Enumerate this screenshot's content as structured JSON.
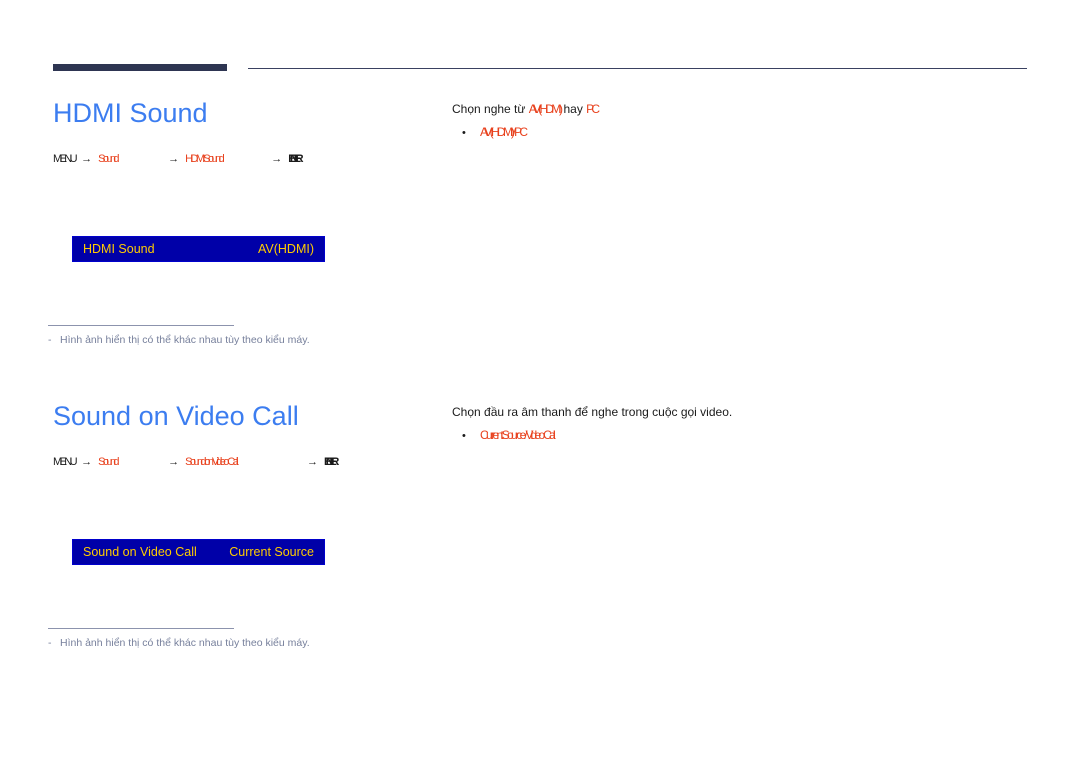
{
  "document": {
    "title": "HDMI Sound / Sound on Video Call"
  },
  "sections": [
    {
      "heading": "HDMI Sound",
      "breadcrumb": {
        "menu": "MENU",
        "arrow": "→",
        "step1": "Sound",
        "step2": "HDMI Sound",
        "enter": "ENTER"
      },
      "osd": {
        "label": "HDMI Sound",
        "value": "AV(HDMI)"
      },
      "footnote": {
        "dash": "-",
        "text": "Hình ảnh hiển thị có thể khác nhau tùy theo kiểu máy."
      },
      "description": {
        "lead": "Chọn nghe từ ",
        "highlight1": "AV(HDMI)",
        "mid": " hay ",
        "highlight2": "PC",
        "tail": ""
      },
      "bullets": [
        {
          "dot": "•",
          "label": "AV(HDMI) / PC"
        }
      ]
    },
    {
      "heading": "Sound on Video Call",
      "breadcrumb": {
        "menu": "MENU",
        "arrow": "→",
        "step1": "Sound",
        "step2": "Sound on Video Call",
        "enter": "ENTER"
      },
      "osd": {
        "label": "Sound on Video Call",
        "value": "Current Source"
      },
      "footnote": {
        "dash": "-",
        "text": "Hình ảnh hiển thị có thể khác nhau tùy theo kiểu máy."
      },
      "description": {
        "lead": "Chọn đầu ra âm thanh để nghe trong cuộc gọi video.",
        "highlight1": "",
        "mid": "",
        "highlight2": "",
        "tail": ""
      },
      "bullets": [
        {
          "dot": "•",
          "label": "Current Source / Video Call"
        }
      ]
    }
  ],
  "colors": {
    "heading": "#3c7df0",
    "rule_dark": "#2e3552",
    "osd_background": "#0000a8",
    "osd_text": "#ffcc00",
    "accent_red": "#e8401c",
    "footnote_text": "#77809c"
  }
}
